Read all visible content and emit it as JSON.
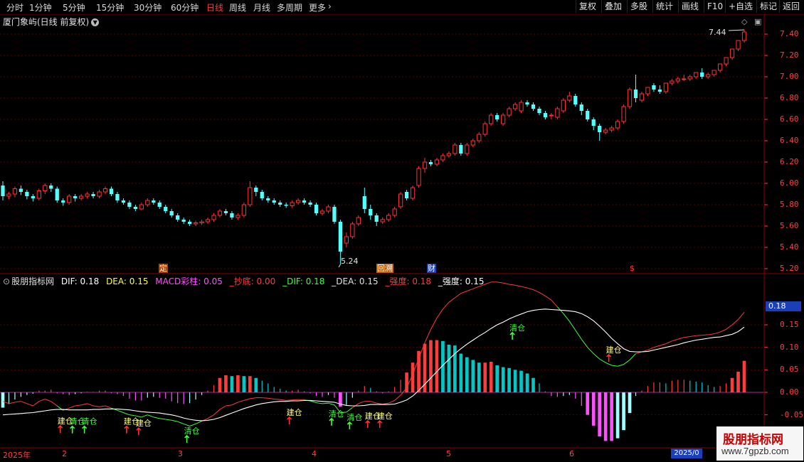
{
  "toolbar": {
    "periods": [
      "分时",
      "1分钟",
      "5分钟",
      "15分钟",
      "30分钟",
      "60分钟",
      "日线",
      "周线",
      "月线",
      "多周期",
      "更多"
    ],
    "active_period": "日线",
    "buttons": [
      "复权",
      "叠加",
      "多股",
      "统计",
      "画线",
      "F10",
      "+自选",
      "返回"
    ]
  },
  "chart_title": "厦门象屿(日线 前复权)",
  "price_axis": [
    "7.40",
    "7.20",
    "7.00",
    "6.80",
    "6.60",
    "6.40",
    "6.20",
    "6.00",
    "5.80",
    "5.60",
    "5.40",
    "5.20"
  ],
  "indicator_axis": [
    "0.15",
    "0.10",
    "0.05",
    "0.00",
    "-0.05"
  ],
  "current_value": "0.18",
  "price_annotations": {
    "high": "7.44",
    "low": "5.24"
  },
  "event_markers": [
    "定",
    "回溯",
    "财",
    "$"
  ],
  "indicator": {
    "name": "股朋指标网",
    "dif": "DIF: 0.18",
    "dea": "DEA: 0.15",
    "macd": "MACD彩柱: 0.05",
    "chaodi": "_抄底: 0.00",
    "dif2": "_DIF: 0.18",
    "dea2": "_DEA: 0.15",
    "qiangdu_red": "_强度: 0.18",
    "qiangdu": "_强度: 0.15"
  },
  "signal_labels": {
    "buy": "建仓",
    "alert": "清仓"
  },
  "x_axis": [
    "2025年",
    "2",
    "3",
    "4",
    "5",
    "6"
  ],
  "date_box": "2025/0",
  "watermark": {
    "title": "股朋指标网",
    "url": "www.7gpzb.com"
  },
  "colors": {
    "up": "#ff3232",
    "down": "#54ffff",
    "dif": "#ffffff",
    "dea": "#ff3b3b",
    "macd_pos": "#ff50ff"
  },
  "chart_data": {
    "type": "candlestick",
    "ylim": [
      5.16,
      7.48
    ],
    "opens": [
      5.98,
      5.88,
      5.9,
      5.95,
      5.92,
      5.88,
      5.86,
      5.93,
      5.98,
      5.95,
      5.84,
      5.82,
      5.88,
      5.86,
      5.88,
      5.9,
      5.88,
      5.92,
      5.95,
      5.9,
      5.84,
      5.82,
      5.78,
      5.76,
      5.8,
      5.84,
      5.82,
      5.78,
      5.74,
      5.7,
      5.66,
      5.64,
      5.62,
      5.63,
      5.64,
      5.66,
      5.7,
      5.74,
      5.72,
      5.68,
      5.7,
      5.8,
      5.96,
      5.92,
      5.86,
      5.84,
      5.82,
      5.8,
      5.79,
      5.82,
      5.84,
      5.82,
      5.8,
      5.72,
      5.74,
      5.78,
      5.64,
      5.44,
      5.5,
      5.62,
      5.88,
      5.76,
      5.7,
      5.64,
      5.66,
      5.7,
      5.78,
      5.92,
      5.86,
      5.98,
      6.14,
      6.2,
      6.18,
      6.22,
      6.26,
      6.28,
      6.36,
      6.28,
      6.36,
      6.4,
      6.46,
      6.56,
      6.64,
      6.56,
      6.64,
      6.7,
      6.68,
      6.76,
      6.74,
      6.7,
      6.66,
      6.64,
      6.62,
      6.68,
      6.78,
      6.82,
      6.74,
      6.68,
      6.6,
      6.54,
      6.48,
      6.5,
      6.52,
      6.58,
      6.72,
      6.88,
      6.78,
      6.84,
      6.92,
      6.88,
      6.86,
      6.94,
      6.96,
      6.98,
      6.98,
      7.0,
      7.04,
      7.0,
      7.02,
      7.06,
      7.12,
      7.18,
      7.26,
      7.34
    ],
    "closes": [
      5.88,
      5.9,
      5.95,
      5.92,
      5.88,
      5.86,
      5.93,
      5.98,
      5.95,
      5.84,
      5.82,
      5.88,
      5.86,
      5.88,
      5.9,
      5.88,
      5.92,
      5.95,
      5.9,
      5.84,
      5.82,
      5.78,
      5.76,
      5.8,
      5.84,
      5.82,
      5.78,
      5.74,
      5.7,
      5.66,
      5.64,
      5.62,
      5.63,
      5.64,
      5.66,
      5.7,
      5.74,
      5.72,
      5.68,
      5.7,
      5.8,
      5.96,
      5.92,
      5.86,
      5.84,
      5.82,
      5.8,
      5.79,
      5.82,
      5.84,
      5.82,
      5.8,
      5.72,
      5.74,
      5.78,
      5.64,
      5.36,
      5.5,
      5.62,
      5.68,
      5.76,
      5.7,
      5.64,
      5.66,
      5.7,
      5.76,
      5.9,
      5.86,
      5.96,
      6.14,
      6.2,
      6.18,
      6.22,
      6.26,
      6.28,
      6.36,
      6.28,
      6.36,
      6.4,
      6.46,
      6.56,
      6.64,
      6.6,
      6.64,
      6.7,
      6.74,
      6.76,
      6.74,
      6.7,
      6.66,
      6.62,
      6.64,
      6.7,
      6.78,
      6.82,
      6.74,
      6.68,
      6.6,
      6.54,
      6.48,
      6.5,
      6.52,
      6.58,
      6.72,
      6.88,
      6.8,
      6.84,
      6.9,
      6.88,
      6.86,
      6.94,
      6.96,
      6.98,
      6.98,
      7.0,
      7.04,
      7.0,
      7.02,
      7.06,
      7.12,
      7.18,
      7.26,
      7.34,
      7.42
    ],
    "lows": [
      5.84,
      5.85,
      5.87,
      5.89,
      5.85,
      5.83,
      5.84,
      5.9,
      5.92,
      5.82,
      5.79,
      5.8,
      5.83,
      5.84,
      5.86,
      5.86,
      5.86,
      5.9,
      5.88,
      5.82,
      5.8,
      5.76,
      5.74,
      5.75,
      5.78,
      5.8,
      5.76,
      5.72,
      5.68,
      5.64,
      5.62,
      5.6,
      5.6,
      5.61,
      5.62,
      5.64,
      5.68,
      5.7,
      5.66,
      5.66,
      5.68,
      5.78,
      5.88,
      5.84,
      5.82,
      5.8,
      5.78,
      5.77,
      5.77,
      5.8,
      5.8,
      5.78,
      5.7,
      5.7,
      5.72,
      5.62,
      5.24,
      5.4,
      5.48,
      5.6,
      5.72,
      5.66,
      5.6,
      5.62,
      5.64,
      5.68,
      5.76,
      5.84,
      5.84,
      5.96,
      6.1,
      6.16,
      6.16,
      6.2,
      6.24,
      6.26,
      6.26,
      6.26,
      6.34,
      6.38,
      6.44,
      6.54,
      6.58,
      6.54,
      6.62,
      6.68,
      6.66,
      6.72,
      6.68,
      6.64,
      6.6,
      6.6,
      6.6,
      6.66,
      6.76,
      6.72,
      6.64,
      6.58,
      6.5,
      6.4,
      6.46,
      6.48,
      6.5,
      6.56,
      6.7,
      6.76,
      6.76,
      6.82,
      6.86,
      6.84,
      6.84,
      6.92,
      6.94,
      6.96,
      6.96,
      6.98,
      6.98,
      6.98,
      7.0,
      7.04,
      7.1,
      7.16,
      7.24,
      7.32
    ],
    "highs": [
      6.02,
      5.92,
      5.97,
      5.98,
      5.94,
      5.9,
      5.95,
      6.0,
      6.0,
      5.97,
      5.86,
      5.9,
      5.9,
      5.9,
      5.92,
      5.92,
      5.94,
      5.97,
      5.97,
      5.92,
      5.86,
      5.84,
      5.8,
      5.82,
      5.86,
      5.86,
      5.84,
      5.8,
      5.76,
      5.72,
      5.68,
      5.66,
      5.65,
      5.66,
      5.68,
      5.72,
      5.76,
      5.76,
      5.74,
      5.72,
      5.82,
      6.02,
      5.98,
      5.94,
      5.88,
      5.86,
      5.84,
      5.82,
      5.84,
      5.86,
      5.86,
      5.84,
      5.82,
      5.76,
      5.8,
      5.8,
      5.66,
      5.54,
      5.64,
      5.7,
      5.96,
      5.8,
      5.72,
      5.68,
      5.72,
      5.78,
      5.92,
      5.94,
      5.98,
      6.16,
      6.24,
      6.22,
      6.24,
      6.28,
      6.3,
      6.38,
      6.38,
      6.38,
      6.42,
      6.48,
      6.58,
      6.66,
      6.66,
      6.66,
      6.72,
      6.76,
      6.78,
      6.78,
      6.76,
      6.72,
      6.68,
      6.66,
      6.72,
      6.8,
      6.86,
      6.84,
      6.76,
      6.7,
      6.62,
      6.56,
      6.52,
      6.54,
      6.6,
      6.74,
      6.9,
      7.02,
      6.86,
      6.88,
      6.94,
      6.92,
      6.9,
      6.98,
      7.0,
      7.02,
      7.02,
      7.04,
      7.08,
      7.04,
      7.06,
      7.1,
      7.16,
      7.22,
      7.3,
      7.44
    ],
    "dif": [
      -0.04,
      -0.045,
      -0.046,
      -0.043,
      -0.044,
      -0.042,
      -0.036,
      -0.034,
      -0.033,
      -0.035,
      -0.04,
      -0.042,
      -0.041,
      -0.04,
      -0.038,
      -0.037,
      -0.036,
      -0.035,
      -0.036,
      -0.038,
      -0.042,
      -0.046,
      -0.05,
      -0.052,
      -0.05,
      -0.05,
      -0.052,
      -0.055,
      -0.06,
      -0.065,
      -0.07,
      -0.072,
      -0.07,
      -0.066,
      -0.06,
      -0.052,
      -0.04,
      -0.032,
      -0.028,
      -0.022,
      -0.018,
      -0.014,
      -0.012,
      -0.012,
      -0.013,
      -0.015,
      -0.016,
      -0.018,
      -0.017,
      -0.016,
      -0.017,
      -0.019,
      -0.023,
      -0.025,
      -0.024,
      -0.028,
      -0.042,
      -0.043,
      -0.036,
      -0.028,
      -0.022,
      -0.022,
      -0.026,
      -0.028,
      -0.026,
      -0.02,
      -0.008,
      0.005,
      0.025,
      0.05,
      0.072,
      0.09,
      0.104,
      0.117,
      0.126,
      0.138,
      0.14,
      0.146,
      0.152,
      0.158,
      0.166,
      0.176,
      0.18,
      0.184,
      0.19,
      0.194,
      0.198,
      0.2,
      0.198,
      0.194,
      0.186,
      0.18,
      0.178,
      0.178,
      0.178,
      0.172,
      0.16,
      0.143,
      0.122,
      0.098,
      0.08,
      0.066,
      0.057,
      0.055,
      0.068,
      0.086,
      0.092,
      0.098,
      0.105,
      0.108,
      0.11,
      0.116,
      0.12,
      0.124,
      0.126,
      0.128,
      0.129,
      0.128,
      0.128,
      0.13,
      0.136,
      0.145,
      0.158,
      0.18
    ],
    "dea": [
      -0.05,
      -0.049,
      -0.048,
      -0.047,
      -0.046,
      -0.045,
      -0.043,
      -0.041,
      -0.039,
      -0.038,
      -0.038,
      -0.039,
      -0.039,
      -0.039,
      -0.039,
      -0.038,
      -0.038,
      -0.037,
      -0.037,
      -0.037,
      -0.038,
      -0.039,
      -0.041,
      -0.043,
      -0.044,
      -0.045,
      -0.046,
      -0.048,
      -0.05,
      -0.053,
      -0.057,
      -0.06,
      -0.062,
      -0.063,
      -0.062,
      -0.06,
      -0.056,
      -0.051,
      -0.046,
      -0.041,
      -0.036,
      -0.032,
      -0.028,
      -0.025,
      -0.023,
      -0.021,
      -0.02,
      -0.02,
      -0.019,
      -0.019,
      -0.018,
      -0.018,
      -0.019,
      -0.02,
      -0.021,
      -0.022,
      -0.026,
      -0.029,
      -0.03,
      -0.03,
      -0.029,
      -0.027,
      -0.027,
      -0.027,
      -0.027,
      -0.026,
      -0.022,
      -0.017,
      -0.008,
      0.004,
      0.018,
      0.032,
      0.046,
      0.06,
      0.073,
      0.086,
      0.097,
      0.107,
      0.116,
      0.125,
      0.133,
      0.142,
      0.15,
      0.156,
      0.163,
      0.169,
      0.174,
      0.179,
      0.182,
      0.184,
      0.185,
      0.184,
      0.183,
      0.182,
      0.181,
      0.179,
      0.175,
      0.168,
      0.159,
      0.147,
      0.134,
      0.12,
      0.108,
      0.097,
      0.091,
      0.09,
      0.09,
      0.091,
      0.094,
      0.097,
      0.1,
      0.103,
      0.106,
      0.11,
      0.113,
      0.116,
      0.118,
      0.12,
      0.122,
      0.123,
      0.126,
      0.129,
      0.135,
      0.145
    ],
    "macd": [
      -0.034,
      -0.026,
      -0.016,
      -0.01,
      -0.006,
      -0.003,
      0.004,
      0.004,
      0.006,
      -0.002,
      -0.004,
      -0.006,
      -0.004,
      -0.002,
      0.001,
      0.001,
      0.004,
      0.004,
      -0.002,
      -0.004,
      -0.008,
      -0.014,
      -0.018,
      -0.018,
      -0.012,
      -0.01,
      -0.012,
      -0.014,
      -0.02,
      -0.024,
      -0.026,
      -0.024,
      -0.016,
      -0.006,
      0.004,
      0.016,
      0.032,
      0.038,
      0.036,
      0.038,
      0.036,
      0.036,
      0.032,
      0.026,
      0.02,
      0.012,
      0.008,
      0.004,
      0.004,
      0.006,
      0.002,
      -0.002,
      -0.008,
      -0.01,
      -0.006,
      -0.012,
      -0.032,
      -0.028,
      -0.012,
      0.004,
      0.014,
      0.01,
      0.002,
      -0.002,
      0.002,
      0.012,
      0.028,
      0.044,
      0.066,
      0.092,
      0.108,
      0.116,
      0.116,
      0.114,
      0.106,
      0.104,
      0.086,
      0.078,
      0.072,
      0.066,
      0.066,
      0.068,
      0.06,
      0.056,
      0.054,
      0.05,
      0.048,
      0.042,
      0.032,
      0.02,
      0.002,
      -0.008,
      -0.01,
      -0.008,
      -0.006,
      -0.014,
      -0.03,
      -0.05,
      -0.074,
      -0.098,
      -0.108,
      -0.108,
      -0.102,
      -0.084,
      -0.046,
      -0.008,
      0.004,
      0.014,
      0.022,
      0.022,
      0.02,
      0.026,
      0.028,
      0.028,
      0.026,
      0.024,
      0.022,
      0.016,
      0.012,
      0.014,
      0.02,
      0.032,
      0.046,
      0.07
    ],
    "qiangdu_green": [
      -0.02,
      -0.025,
      -0.022,
      -0.02,
      -0.025,
      -0.03,
      -0.02,
      -0.015,
      -0.02,
      -0.03,
      -0.04,
      -0.035,
      -0.03,
      -0.028,
      -0.025,
      -0.03,
      -0.032,
      -0.03,
      -0.035,
      -0.04,
      -0.045,
      -0.05,
      -0.052,
      -0.055,
      -0.05,
      -0.055,
      -0.058,
      -0.06,
      -0.062,
      -0.065,
      -0.07,
      -0.075,
      -0.07,
      -0.064,
      -0.058,
      -0.05,
      -0.038,
      -0.03,
      -0.028,
      -0.022,
      -0.018,
      -0.014,
      -0.012,
      -0.012,
      -0.013,
      -0.015,
      -0.016,
      -0.018,
      -0.017,
      -0.016,
      -0.017,
      -0.019,
      -0.023,
      -0.025,
      -0.024,
      -0.028,
      -0.045,
      -0.044,
      -0.034,
      -0.025,
      -0.02,
      -0.02,
      -0.024,
      -0.026,
      -0.024,
      -0.018,
      -0.006,
      0.01,
      0.04,
      0.075,
      0.11,
      0.14,
      0.165,
      0.185,
      0.2,
      0.21,
      0.22,
      0.225,
      0.23,
      0.235,
      0.24,
      0.245,
      0.245,
      0.243,
      0.24,
      0.238,
      0.235,
      0.232,
      0.228,
      0.222,
      0.214,
      0.205,
      0.19,
      0.175,
      0.158,
      0.138,
      0.118,
      0.1,
      0.086,
      0.074,
      0.066,
      0.06,
      0.058,
      0.062,
      0.072,
      0.086,
      0.09,
      0.094,
      0.1,
      0.104,
      0.108,
      0.114,
      0.118,
      0.122,
      0.124,
      0.126,
      0.127,
      0.128,
      0.13,
      0.134,
      0.14,
      0.15,
      0.162,
      0.178
    ]
  }
}
